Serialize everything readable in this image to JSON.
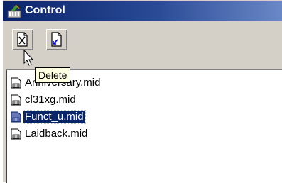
{
  "window": {
    "title": "Control"
  },
  "toolbar": {
    "buttons": [
      {
        "name": "delete",
        "icon": "delete-file-icon"
      },
      {
        "name": "import",
        "icon": "import-file-icon"
      }
    ]
  },
  "tooltip": {
    "text": "Delete"
  },
  "files": {
    "items": [
      {
        "label": "Anniversary.mid",
        "icon": "midi-file-icon",
        "selected": false
      },
      {
        "label": "cl31xg.mid",
        "icon": "midi-file-icon",
        "selected": false
      },
      {
        "label": "Funct_u.mid",
        "icon": "midi-file-icon",
        "selected": true
      },
      {
        "label": "Laidback.mid",
        "icon": "midi-file-icon",
        "selected": false
      }
    ]
  },
  "colors": {
    "titlebar": "#0a246a",
    "selection": "#0a246a",
    "tooltip": "#ffffe1",
    "face": "#d4d0c8"
  }
}
